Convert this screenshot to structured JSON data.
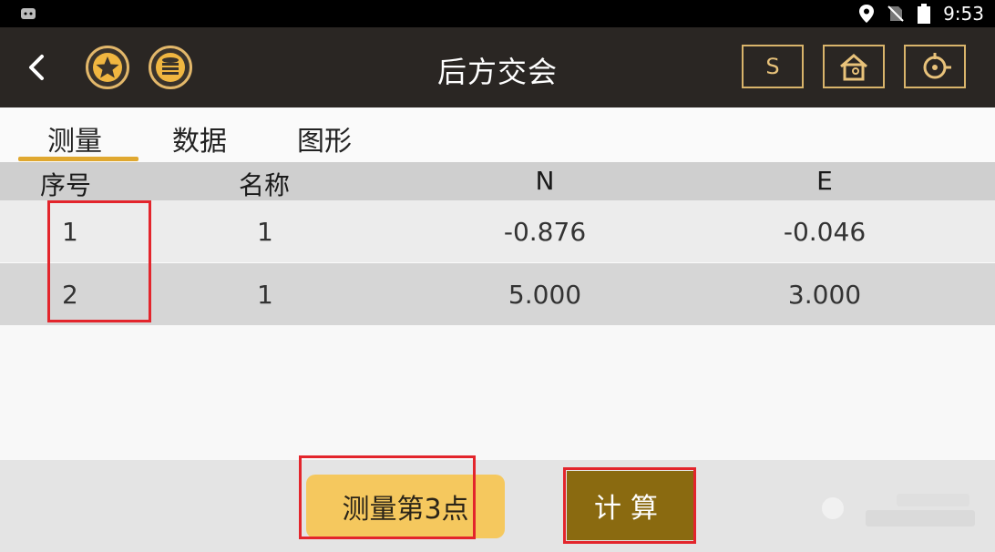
{
  "status_bar": {
    "time": "9:53"
  },
  "app_bar": {
    "title": "后方交会",
    "s_label": "S"
  },
  "tabs": [
    {
      "label": "测量",
      "active": true
    },
    {
      "label": "数据",
      "active": false
    },
    {
      "label": "图形",
      "active": false
    }
  ],
  "table": {
    "headers": {
      "index": "序号",
      "name": "名称",
      "n": "N",
      "e": "E"
    },
    "rows": [
      {
        "index": "1",
        "name": "1",
        "n": "-0.876",
        "e": "-0.046"
      },
      {
        "index": "2",
        "name": "1",
        "n": "5.000",
        "e": "3.000"
      }
    ]
  },
  "bottom": {
    "measure_label": "测量第3点",
    "calc_label": "计算"
  },
  "colors": {
    "accent": "#e0a830",
    "app_bar": "#2a2623",
    "calc_button": "#8a6a10",
    "measure_button": "#f5c85e",
    "annotation": "#e3252c"
  },
  "icons": [
    "back-icon",
    "star-icon",
    "coins-icon",
    "home-icon",
    "target-icon",
    "location-icon",
    "no-sim-icon",
    "battery-icon"
  ]
}
